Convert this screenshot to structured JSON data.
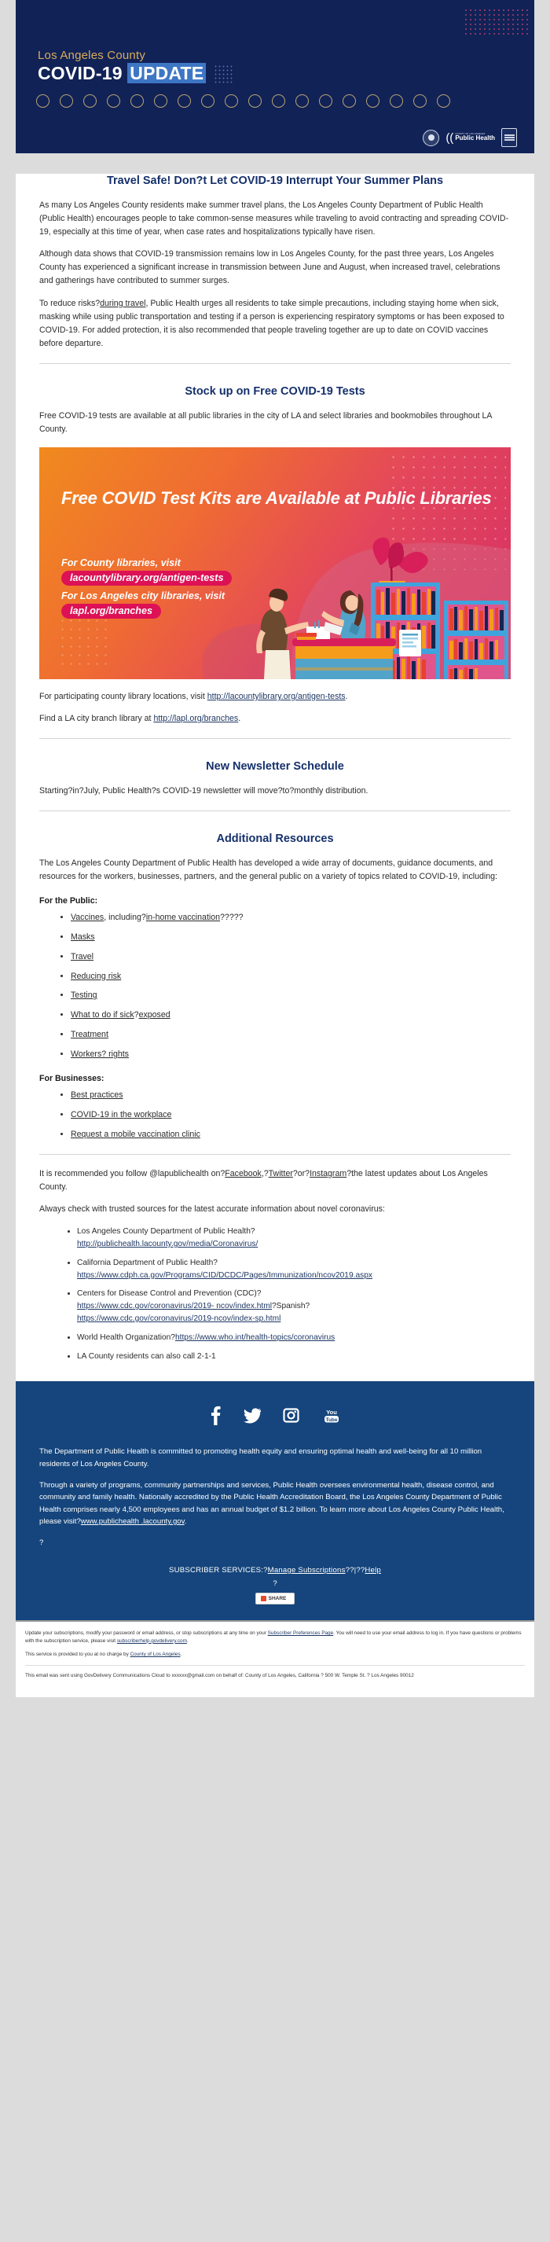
{
  "colors": {
    "header_bg": "#112257",
    "footer_bg": "#15457c",
    "heading": "#15306b",
    "promo_from": "#f08a1e",
    "promo_to": "#d62f63",
    "pill": "#dd1155",
    "gold": "#d9ad5a",
    "highlight": "#3d76c4"
  },
  "header": {
    "county": "Los Angeles County",
    "title_main": "COVID-19",
    "title_highlight": "UPDATE",
    "circle_count": 18,
    "logos": {
      "seal_name": "la-county-seal",
      "public_health_top": "COUNTY OF LOS ANGELES",
      "public_health_main": "Public Health",
      "badge_name": "accreditation-badge"
    }
  },
  "article": {
    "title": "Travel Safe! Don?t Let COVID-19 Interrupt Your Summer Plans",
    "p1": "As many Los Angeles County residents make summer travel plans, the Los Angeles County Department of Public Health (Public Health) encourages people to take common-sense measures while traveling to avoid contracting and spreading COVID-19, especially at this time of year, when case rates and hospitalizations typically have risen.",
    "p2": "Although data shows that COVID-19 transmission remains low in Los Angeles County, for the past three years, Los Angeles County has experienced a significant increase in transmission between June and August, when increased travel, celebrations and gatherings have contributed to summer surges.",
    "p3_a": "To reduce risks?",
    "p3_link": "during travel",
    "p3_b": ", Public Health urges all residents to take simple precautions, including staying home when sick, masking while using public transportation and testing if a person is experiencing respiratory symptoms or has been exposed to COVID-19. For added protection, it is also recommended that people traveling together are up to date on COVID vaccines before departure."
  },
  "tests_section": {
    "title": "Stock up on Free COVID-19 Tests",
    "intro": "Free COVID-19 tests are available at all public libraries in the city of LA and select libraries and bookmobiles throughout LA County.",
    "promo": {
      "headline": "Free COVID Test Kits are Available at Public Libraries",
      "lead1": "For County libraries, visit",
      "url1": "lacountylibrary.org/antigen-tests",
      "lead2": "For Los Angeles city libraries, visit",
      "url2": "lapl.org/branches"
    },
    "after1_a": "For participating county library locations, visit ",
    "after1_link": "http://lacountylibrary.org/antigen-tests",
    "after1_b": ".",
    "after2_a": "Find a LA city branch library at ",
    "after2_link": "http://lapl.org/branches",
    "after2_b": "."
  },
  "newsletter_section": {
    "title": "New Newsletter Schedule",
    "body": "Starting?in?July, Public Health?s COVID-19 newsletter will move?to?monthly distribution."
  },
  "resources_section": {
    "title": "Additional Resources",
    "intro": "The Los Angeles County Department of Public Health has developed a wide array of documents, guidance documents, and resources for the workers, businesses, partners, and the general public on a variety of topics related to COVID-19, including:",
    "public_heading": "For the Public:",
    "public_items": [
      {
        "link": "Vaccines",
        "mid": ", including?",
        "link2": "in-home vaccination",
        "tail": "?????"
      },
      {
        "link": "Masks"
      },
      {
        "link": "Travel"
      },
      {
        "link": "Reducing risk"
      },
      {
        "link": "Testing"
      },
      {
        "link": "What to do if sick",
        "mid": "?",
        "link2": "exposed"
      },
      {
        "link": "Treatment"
      },
      {
        "link": "Workers? rights"
      }
    ],
    "business_heading": "For Businesses:",
    "business_items": [
      {
        "link": "Best practices"
      },
      {
        "link": "COVID-19 in the workplace"
      },
      {
        "link": "Request a mobile vaccination clinic"
      }
    ]
  },
  "social_follow": {
    "pre": "It is recommended you follow @lapublichealth on?",
    "fb": "Facebook",
    "sep1": ",?",
    "tw": "Twitter",
    "sep2": "?or?",
    "ig": "Instagram",
    "post": "?the latest updates about Los Angeles County."
  },
  "trusted": {
    "intro": "Always check with trusted sources for the latest accurate information about novel coronavirus:",
    "items": [
      {
        "label": "Los Angeles County Department of Public Health?",
        "urls": [
          "http://publichealth.lacounty.gov/media/Coronavirus/"
        ]
      },
      {
        "label": "California Department of Public Health?",
        "urls": [
          "https://www.cdph.ca.gov/Programs/CID/DCDC/Pages/Immunization/ncov2019.aspx"
        ]
      },
      {
        "label": "Centers for Disease Control and Prevention (CDC)?",
        "urls": [
          "https://www.cdc.gov/coronavirus/2019- ncov/index.html",
          "?Spanish?",
          "https://www.cdc.gov/coronavirus/2019-ncov/index-sp.html"
        ]
      },
      {
        "label": "World Health Organization?",
        "urls": [
          "https://www.who.int/health-topics/coronavirus"
        ]
      },
      {
        "label": "LA County residents can also call 2-1-1",
        "urls": []
      }
    ]
  },
  "footer": {
    "social_icons": [
      "facebook-icon",
      "twitter-icon",
      "instagram-icon",
      "youtube-icon"
    ],
    "p1": "The Department of Public Health is committed to promoting health equity and ensuring optimal health and well-being for all 10 million residents of Los Angeles County.",
    "p2_a": "Through a variety of programs, community partnerships and services, Public Health oversees environmental health, disease control, and community and family health. Nationally accredited by the Public Health Accreditation Board, the Los Angeles County Department of Public Health comprises nearly 4,500 employees and has an annual budget of $1.2 billion. To learn more about Los Angeles County Public Health, please visit?",
    "p2_link": "www.publichealth .lacounty.gov",
    "p2_b": ".",
    "p3": "?",
    "subscriber_label": "SUBSCRIBER SERVICES:?",
    "manage_link": "Manage Subscriptions",
    "subscriber_sep": "??|??",
    "help_link": "Help",
    "qmark": "?",
    "share_label": "SHARE"
  },
  "legal": {
    "line1_a": "Update your subscriptions, modify your password or email address, or stop subscriptions at any time on your ",
    "line1_link1": "Subscriber Preferences Page",
    "line1_b": ". You will need to use your email address to log in. If you have questions or problems with the subscription service, please visit ",
    "line1_link2": "subscriberhelp.govdelivery.com",
    "line1_c": ".",
    "line2_a": "This service is provided to you at no charge by ",
    "line2_link": "County of Los Angeles",
    "line2_b": ".",
    "line3": "This email was sent using GovDelivery Communications Cloud to xxxxxx@gmail.com on behalf of: County of Los Angeles, California ? 500 W. Temple St. ? Los Angeles 90012"
  }
}
